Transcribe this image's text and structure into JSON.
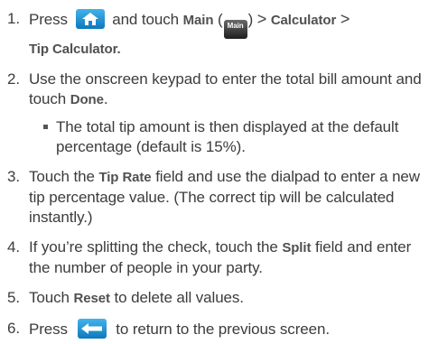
{
  "steps": [
    {
      "number": "1.",
      "parts": {
        "press": "Press",
        "and_touch": "and touch",
        "main": "Main",
        "open_paren": "(",
        "main_icon_text": "Main",
        "close_paren": ")",
        "sep1": ">",
        "calculator": "Calculator",
        "sep2": ">",
        "tip_calculator": "Tip Calculator."
      },
      "icons": [
        "home-key-icon",
        "main-menu-icon"
      ]
    },
    {
      "number": "2.",
      "parts": {
        "text1": "Use the onscreen keypad to enter the total bill amount and touch",
        "done": "Done",
        "period": "."
      },
      "sub": {
        "text": "The total tip amount is then displayed at the default percentage (default is 15%)."
      }
    },
    {
      "number": "3.",
      "parts": {
        "text1": "Touch the",
        "tip_rate": "Tip Rate",
        "text2": "field and use the dialpad to enter a new tip percentage value. (The correct tip will be calculated instantly.)"
      }
    },
    {
      "number": "4.",
      "parts": {
        "text1": "If you’re splitting the check, touch the",
        "split": "Split",
        "text2": "field and enter the number of people in your party."
      }
    },
    {
      "number": "5.",
      "parts": {
        "text1": "Touch",
        "reset": "Reset",
        "text2": "to delete all values."
      }
    },
    {
      "number": "6.",
      "parts": {
        "press": "Press",
        "text2": "to return to the previous screen."
      },
      "icons": [
        "back-key-icon"
      ]
    }
  ],
  "colors": {
    "text": "#3c3c3c",
    "key_blue_top": "#43b3ea",
    "key_blue_bottom": "#0d78bd",
    "main_icon_bg": "#1e1e1e"
  }
}
